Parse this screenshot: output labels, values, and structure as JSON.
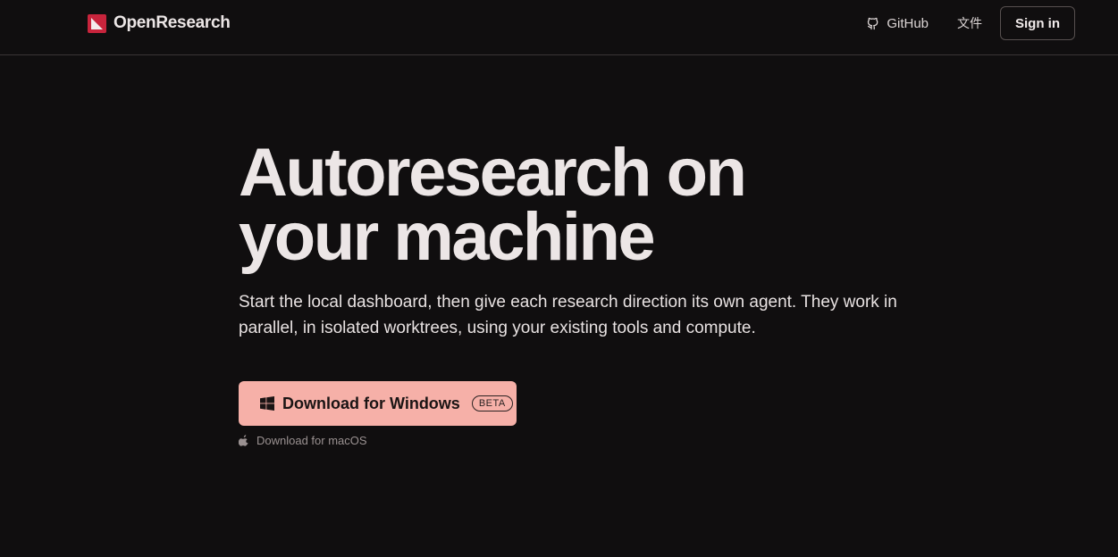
{
  "header": {
    "brand_name": "OpenResearch",
    "nav": {
      "github_label": "GitHub",
      "language_label": "文件",
      "signin_label": "Sign in"
    }
  },
  "hero": {
    "title_line1": "Autoresearch on",
    "title_line2": "your machine",
    "subtitle": "Start the local dashboard, then give each research direction its own agent. They work in parallel, in isolated worktrees, using your existing tools and compute.",
    "primary_cta": {
      "label": "Download for Windows",
      "badge": "BETA",
      "icon": "windows-icon"
    },
    "secondary_cta": {
      "label": "Download for macOS",
      "icon": "apple-icon"
    }
  },
  "colors": {
    "background": "#100e0f",
    "brand": "#c8243c",
    "cta_background": "#f6b0a8",
    "text": "#ece6e6",
    "muted_text": "#9a9191"
  }
}
